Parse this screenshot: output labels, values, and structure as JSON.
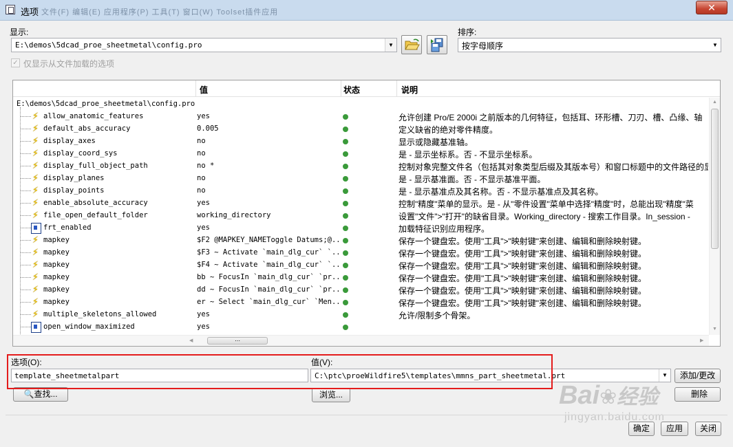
{
  "window": {
    "title": "选项",
    "ghost_menu": "文件(F)  编辑(E)  应用程序(P)  工具(T)  窗口(W)  Toolset插件应用"
  },
  "display": {
    "label": "显示:",
    "path": "E:\\demos\\5dcad_proe_sheetmetal\\config.pro"
  },
  "sort": {
    "label": "排序:",
    "value": "按字母顺序"
  },
  "filter": {
    "label": "仅显示从文件加载的选项",
    "checked": true
  },
  "table": {
    "headers": {
      "value": "值",
      "status": "状态",
      "desc": "说明"
    },
    "root": "E:\\demos\\5dcad_proe_sheetmetal\\config.pro",
    "rows": [
      {
        "name": "allow_anatomic_features",
        "icon": "bolt",
        "value": "yes",
        "desc": "允许创建 Pro/E 2000i 之前版本的几何特征，包括耳、环形槽、刀刃、槽、凸缘、轴"
      },
      {
        "name": "default_abs_accuracy",
        "icon": "bolt",
        "value": "0.005",
        "desc": "定义缺省的绝对零件精度。"
      },
      {
        "name": "display_axes",
        "icon": "bolt",
        "value": "no",
        "desc": "显示或隐藏基准轴。"
      },
      {
        "name": "display_coord_sys",
        "icon": "bolt",
        "value": "no",
        "desc": "是 - 显示坐标系。否 - 不显示坐标系。"
      },
      {
        "name": "display_full_object_path",
        "icon": "bolt",
        "value": "no *",
        "desc": "控制对象完整文件名（包括其对象类型后缀及其版本号）和窗口标题中的文件路径的显"
      },
      {
        "name": "display_planes",
        "icon": "bolt",
        "value": "no",
        "desc": "是 - 显示基准面。否 - 不显示基准平面。"
      },
      {
        "name": "display_points",
        "icon": "bolt",
        "value": "no",
        "desc": "是 - 显示基准点及其名称。否 - 不显示基准点及其名称。"
      },
      {
        "name": "enable_absolute_accuracy",
        "icon": "bolt",
        "value": "yes",
        "desc": "控制\"精度\"菜单的显示。是 - 从\"零件设置\"菜单中选择\"精度\"时，总能出现\"精度\"菜"
      },
      {
        "name": "file_open_default_folder",
        "icon": "bolt",
        "value": "working_directory",
        "desc": "设置\"文件\">\"打开\"的缺省目录。Working_directory - 搜索工作目录。In_session -"
      },
      {
        "name": "frt_enabled",
        "icon": "box",
        "value": "yes",
        "desc": "加载特征识别应用程序。"
      },
      {
        "name": "mapkey",
        "icon": "bolt",
        "value": "$F2 @MAPKEY_NAMEToggle Datums;@...",
        "desc": "保存一个键盘宏。使用\"工具\">\"映射键\"来创建、编辑和删除映射键。"
      },
      {
        "name": "mapkey",
        "icon": "bolt",
        "value": "$F3 ~ Activate `main_dlg_cur` `...",
        "desc": "保存一个键盘宏。使用\"工具\">\"映射键\"来创建、编辑和删除映射键。"
      },
      {
        "name": "mapkey",
        "icon": "bolt",
        "value": "$F4 ~ Activate `main_dlg_cur` `...",
        "desc": "保存一个键盘宏。使用\"工具\">\"映射键\"来创建、编辑和删除映射键。"
      },
      {
        "name": "mapkey",
        "icon": "bolt",
        "value": "bb ~ FocusIn `main_dlg_cur` `pr...",
        "desc": "保存一个键盘宏。使用\"工具\">\"映射键\"来创建、编辑和删除映射键。"
      },
      {
        "name": "mapkey",
        "icon": "bolt",
        "value": "dd ~ FocusIn `main_dlg_cur` `pr...",
        "desc": "保存一个键盘宏。使用\"工具\">\"映射键\"来创建、编辑和删除映射键。"
      },
      {
        "name": "mapkey",
        "icon": "bolt",
        "value": "er ~ Select `main_dlg_cur` `Men...",
        "desc": "保存一个键盘宏。使用\"工具\">\"映射键\"来创建、编辑和删除映射键。"
      },
      {
        "name": "multiple_skeletons_allowed",
        "icon": "bolt",
        "value": "yes",
        "desc": "允许/限制多个骨架。"
      },
      {
        "name": "open_window_maximized",
        "icon": "box",
        "value": "yes",
        "desc": ""
      }
    ]
  },
  "option": {
    "label": "选项(O):",
    "value": "template_sheetmetalpart"
  },
  "value": {
    "label": "值(V):",
    "value": "C:\\ptc\\proeWildfire5\\templates\\mmns_part_sheetmetal.prt"
  },
  "buttons": {
    "find": "查找...",
    "browse": "浏览...",
    "add_change": "添加/更改",
    "delete": "删除",
    "ok": "确定",
    "apply": "应用",
    "close": "关闭"
  },
  "watermark": {
    "brand": "Bai",
    "brand2": "经验",
    "url": "jingyan.baidu.com"
  },
  "colors": {
    "status_ok": "#3a9a3a",
    "highlight": "#e41b1b",
    "titlebar": "#c9dbee"
  }
}
